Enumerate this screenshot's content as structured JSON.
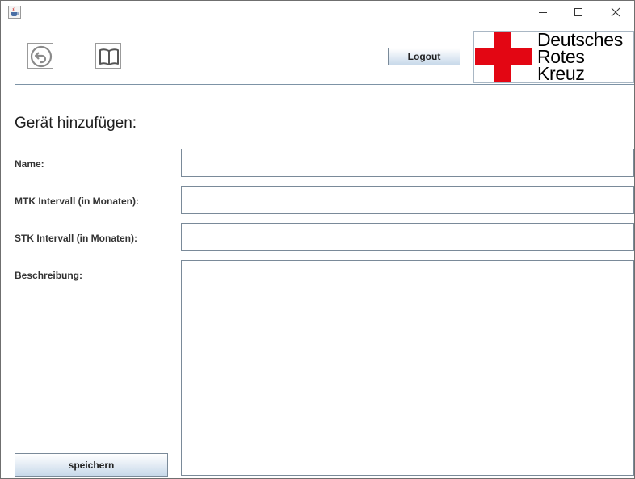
{
  "window": {
    "icons": {
      "app": "java-cup-icon",
      "minimize": "minimize-icon",
      "maximize": "maximize-icon",
      "close": "close-icon"
    }
  },
  "toolbar": {
    "back_icon": "back-arrow-icon",
    "manual_icon": "book-icon",
    "logout_label": "Logout"
  },
  "logo": {
    "lines": [
      "Deutsches",
      "Rotes",
      "Kreuz"
    ],
    "cross_color": "#e30613"
  },
  "form": {
    "title": "Gerät hinzufügen:",
    "fields": {
      "name_label": "Name:",
      "name_value": "",
      "mtk_label": "MTK Intervall (in Monaten):",
      "mtk_value": "",
      "stk_label": "STK Intervall (in Monaten):",
      "stk_value": "",
      "description_label": "Beschreibung:",
      "description_value": ""
    },
    "save_label": "speichern"
  },
  "colors": {
    "accent": "#7d93a6",
    "button_gradient_bottom": "#c8d9ea"
  }
}
